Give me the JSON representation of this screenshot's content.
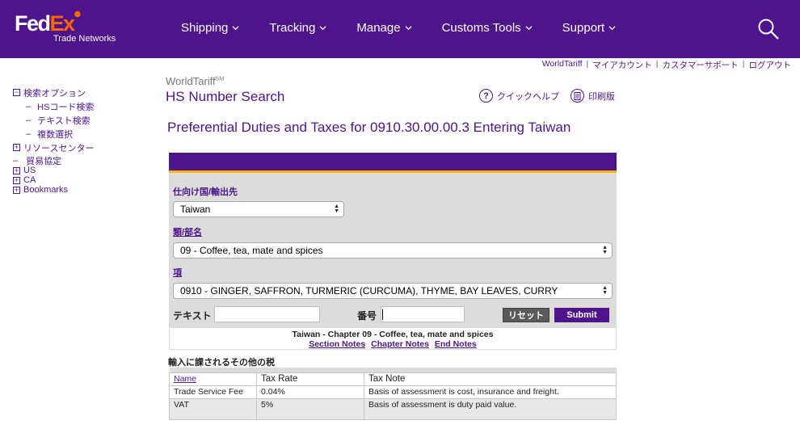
{
  "header": {
    "logo_fed": "Fed",
    "logo_ex": "Ex",
    "logo_sub": "Trade Networks",
    "nav": [
      "Shipping",
      "Tracking",
      "Manage",
      "Customs Tools",
      "Support"
    ]
  },
  "util_links": [
    "WorldTariff",
    "マイアカウント",
    "カスタマーサポート",
    "ログアウト"
  ],
  "sidebar": {
    "search_options": "検索オプション",
    "hs_code_search": "HSコード検索",
    "text_search": "テキスト検索",
    "multi_select": "複数選択",
    "resource_center": "リソースセンター",
    "trade_agreements": "貿易協定",
    "us": "US",
    "ca": "CA",
    "bookmarks": "Bookmarks"
  },
  "main": {
    "worldtariff": "WorldTariff",
    "worldtariff_sup": "SM",
    "hs_title": "HS Number Search",
    "quick_help": "クイックヘルプ",
    "print": "印刷版",
    "page_title": "Preferential Duties and Taxes for 0910.30.00.00.3 Entering Taiwan"
  },
  "form": {
    "dest_label": "仕向け国/輸出先",
    "dest_value": "Taiwan",
    "chapter_label": "類/部名",
    "chapter_value": "09 - Coffee, tea, mate and spices",
    "heading_label": "項",
    "heading_value": "0910 - GINGER, SAFFRON, TURMERIC (CURCUMA), THYME, BAY LEAVES, CURRY",
    "text_label": "テキスト",
    "text_value": "",
    "number_label": "番号",
    "number_value": "",
    "reset_label": "リセット",
    "submit_label": "Submit"
  },
  "chapter": {
    "title": "Taiwan - Chapter 09 - Coffee, tea, mate and spices",
    "section_notes": "Section Notes",
    "chapter_notes": "Chapter Notes",
    "end_notes": "End Notes"
  },
  "other_taxes": {
    "heading": "輸入に課されるその他の税",
    "columns": [
      "Name",
      "Tax Rate",
      "Tax Note"
    ],
    "rows": [
      {
        "name": "Trade Service Fee",
        "rate": "0.04%",
        "note": "Basis of assessment is cost, insurance and freight."
      },
      {
        "name": "VAT",
        "rate": "5%",
        "note": "Basis of assessment is duty paid value."
      }
    ]
  },
  "colors": {
    "brand_purple": "#4d148c",
    "brand_orange": "#ff6600",
    "accent_yellow": "#ffb800"
  }
}
